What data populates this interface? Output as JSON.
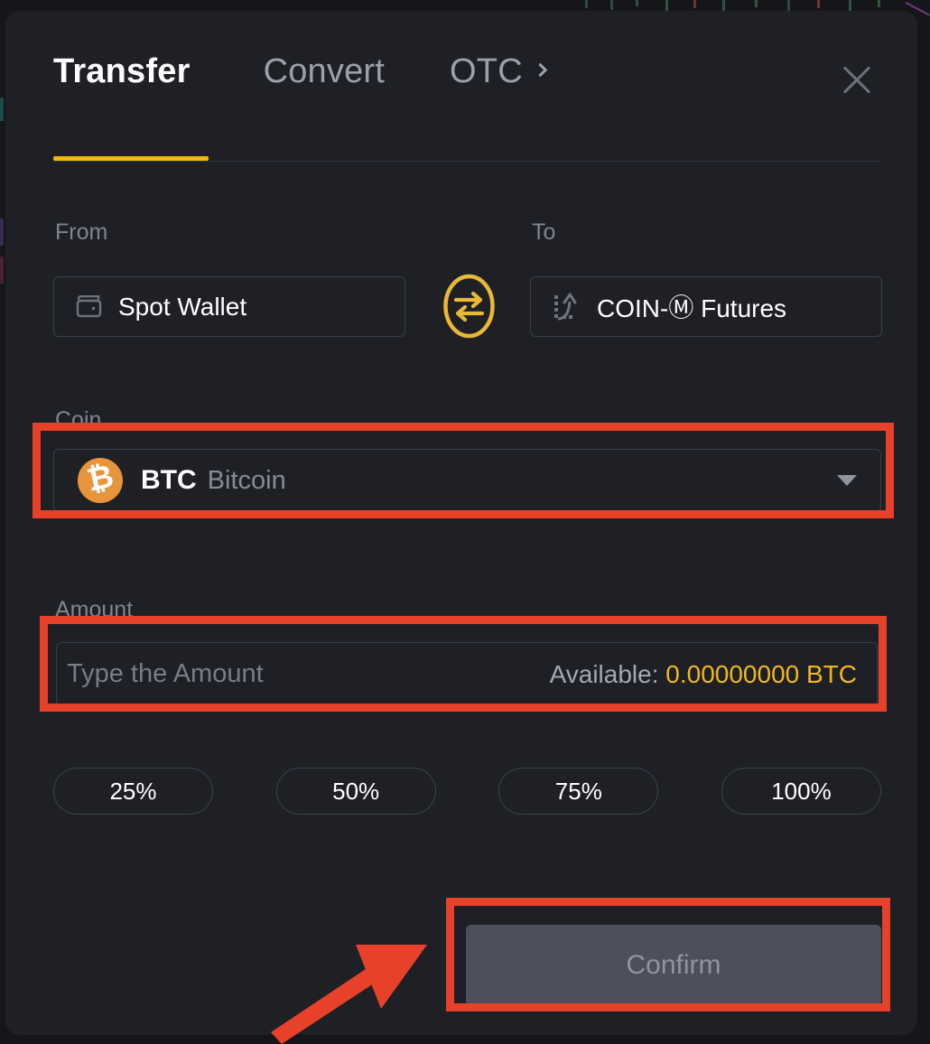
{
  "modal": {
    "tabs": [
      {
        "label": "Transfer",
        "active": true,
        "name": "tab-transfer"
      },
      {
        "label": "Convert",
        "active": false,
        "name": "tab-convert"
      },
      {
        "label": "OTC",
        "active": false,
        "name": "tab-otc",
        "chevron": "chevron-right-icon"
      }
    ],
    "close_icon": "close-icon",
    "accent_color": "#F0B90B",
    "background_color": "#1E2026"
  },
  "transfer": {
    "from": {
      "label": "From",
      "value": "Spot Wallet",
      "icon": "wallet-icon"
    },
    "to": {
      "label": "To",
      "value_prefix": "COIN-",
      "value_mark": "Ⓜ",
      "value_suffix": " Futures",
      "value_full": "COIN-Ⓜ Futures",
      "icon": "futures-chart-icon"
    },
    "swap_icon": "swap-arrows-icon",
    "coin": {
      "label": "Coin",
      "symbol": "BTC",
      "name": "Bitcoin",
      "logo_icon": "bitcoin-icon",
      "logo_glyph": "₿",
      "logo_color": "#E8943A",
      "caret_icon": "caret-down-icon"
    },
    "amount": {
      "label": "Amount",
      "value": "",
      "placeholder": "Type the Amount",
      "available_label": "Available:",
      "available_value": "0.00000000 BTC",
      "available_color": "#EFB81C"
    },
    "percent_buttons": [
      "25%",
      "50%",
      "75%",
      "100%"
    ],
    "confirm": {
      "label": "Confirm",
      "disabled": true
    }
  },
  "annotations": {
    "color": "#E8412A",
    "boxes": [
      "coin-selector",
      "amount-field",
      "confirm-button"
    ],
    "arrow": "points-to-confirm-button"
  }
}
